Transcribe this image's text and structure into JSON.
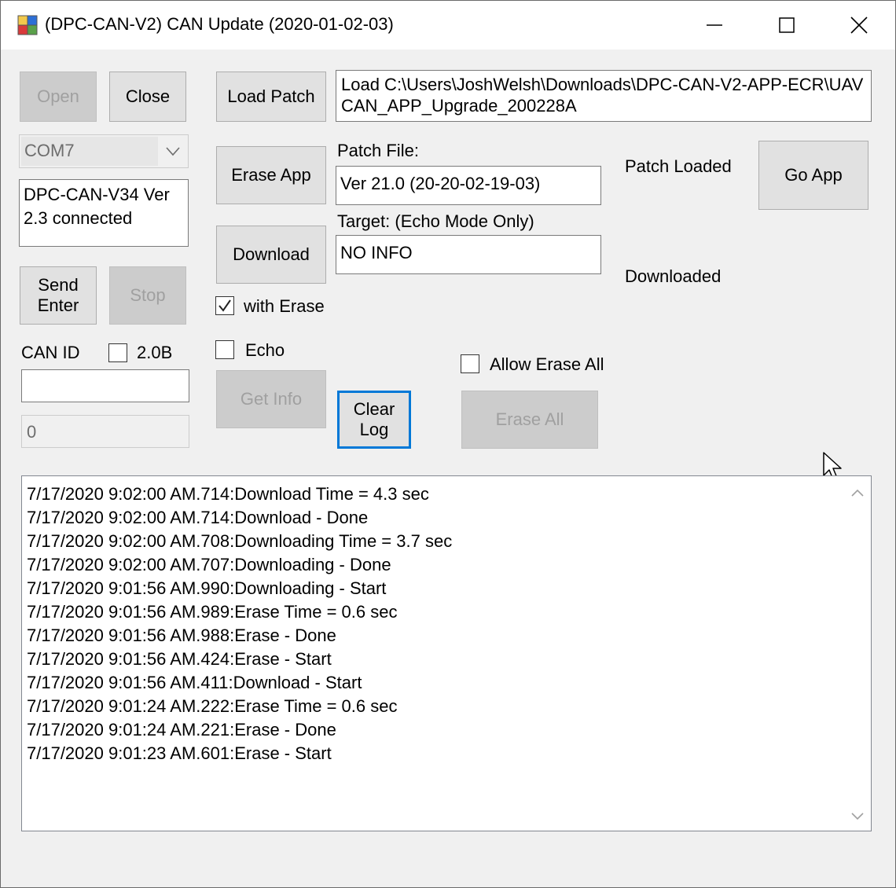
{
  "window": {
    "title": "(DPC-CAN-V2) CAN Update (2020-01-02-03)"
  },
  "buttons": {
    "open": "Open",
    "close": "Close",
    "load_patch": "Load Patch",
    "erase_app": "Erase App",
    "download": "Download",
    "go_app": "Go App",
    "send_enter": "Send\nEnter",
    "stop": "Stop",
    "get_info": "Get Info",
    "clear_log": "Clear\nLog",
    "erase_all": "Erase All"
  },
  "port": {
    "selected": "COM7"
  },
  "status": {
    "connection": "DPC-CAN-V34 Ver 2.3 connected"
  },
  "load_path": "Load C:\\Users\\JoshWelsh\\Downloads\\DPC-CAN-V2-APP-ECR\\UAVCAN_APP_Upgrade_200228A",
  "patch": {
    "file_label": "Patch File:",
    "file_value": "Ver 21.0 (20-20-02-19-03)",
    "target_label": "Target: (Echo Mode Only)",
    "target_value": "NO INFO",
    "loaded_status": "Patch Loaded",
    "downloaded_status": "Downloaded"
  },
  "options": {
    "with_erase": {
      "label": "with Erase",
      "checked": true
    },
    "echo": {
      "label": "Echo",
      "checked": false
    },
    "allow_erase_all": {
      "label": "Allow Erase All",
      "checked": false
    },
    "can20b": {
      "label": "2.0B",
      "checked": false
    }
  },
  "can": {
    "id_label": "CAN ID",
    "id_value": "",
    "count_value": "0"
  },
  "log": [
    "7/17/2020 9:02:00 AM.714:Download Time = 4.3 sec",
    "7/17/2020 9:02:00 AM.714:Download - Done",
    "7/17/2020 9:02:00 AM.708:Downloading Time = 3.7 sec",
    "7/17/2020 9:02:00 AM.707:Downloading - Done",
    "7/17/2020 9:01:56 AM.990:Downloading - Start",
    "7/17/2020 9:01:56 AM.989:Erase Time = 0.6 sec",
    "7/17/2020 9:01:56 AM.988:Erase - Done",
    "7/17/2020 9:01:56 AM.424:Erase - Start",
    "7/17/2020 9:01:56 AM.411:Download - Start",
    "7/17/2020 9:01:24 AM.222:Erase Time = 0.6 sec",
    "7/17/2020 9:01:24 AM.221:Erase - Done",
    "7/17/2020 9:01:23 AM.601:Erase - Start"
  ]
}
